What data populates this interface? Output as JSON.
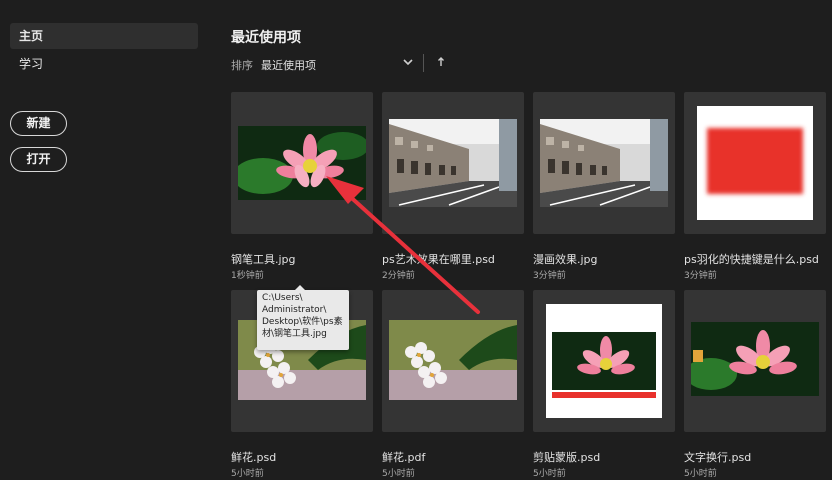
{
  "sidebar": {
    "items": [
      {
        "label": "主页"
      },
      {
        "label": "学习"
      }
    ],
    "buttons": {
      "new_label": "新建",
      "open_label": "打开"
    }
  },
  "main": {
    "title": "最近使用项",
    "sort": {
      "label": "排序",
      "value": "最近使用项"
    }
  },
  "files": [
    {
      "name": "钢笔工具.jpg",
      "time": "1秒钟前",
      "thumb": "lotus"
    },
    {
      "name": "ps艺术效果在哪里.psd",
      "time": "2分钟前",
      "thumb": "street"
    },
    {
      "name": "漫画效果.jpg",
      "time": "3分钟前",
      "thumb": "street"
    },
    {
      "name": "ps羽化的快捷键是什么.psd",
      "time": "3分钟前",
      "thumb": "red-feather"
    },
    {
      "name": "鲜花.psd",
      "time": "5小时前",
      "thumb": "flowers"
    },
    {
      "name": "鲜花.pdf",
      "time": "5小时前",
      "thumb": "flowers"
    },
    {
      "name": "剪贴蒙版.psd",
      "time": "5小时前",
      "thumb": "lotus-framed"
    },
    {
      "name": "文字换行.psd",
      "time": "5小时前",
      "thumb": "lotus"
    }
  ],
  "tooltip": {
    "lines": [
      "C:\\Users\\",
      "Administrator\\",
      "Desktop\\软件\\ps素",
      "材\\钢笔工具.jpg"
    ]
  },
  "colors": {
    "background": "#1e1e1e",
    "card": "#343434",
    "annotation_arrow": "#e8313b"
  }
}
